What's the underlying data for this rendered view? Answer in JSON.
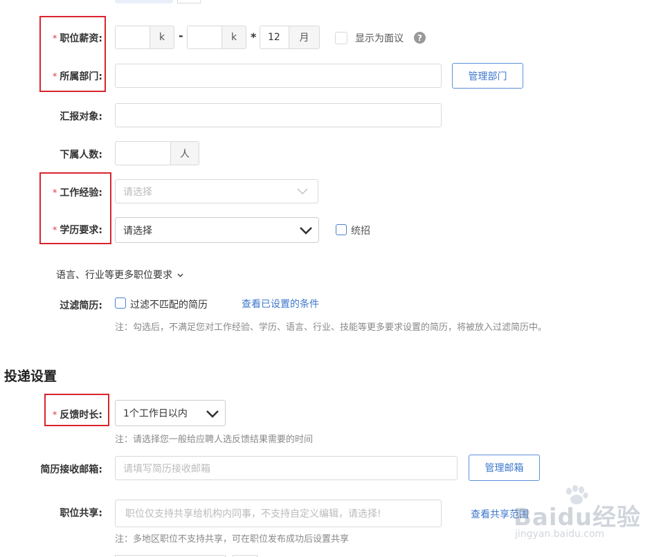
{
  "salary": {
    "label": "职位薪资:",
    "unit_k": "k",
    "dash": "-",
    "times": "*",
    "months_value": "12",
    "months_unit": "月",
    "negotiable": "显示为面议",
    "help_icon": "?"
  },
  "department": {
    "label": "所属部门:",
    "manage_button": "管理部门"
  },
  "report_to": {
    "label": "汇报对象:"
  },
  "subordinates": {
    "label": "下属人数:",
    "unit": "人"
  },
  "experience": {
    "label": "工作经验:",
    "placeholder": "请选择"
  },
  "education": {
    "label": "学历要求:",
    "value": "请选择",
    "unified": "统招"
  },
  "more_requirements": {
    "label": "语言、行业等更多职位要求"
  },
  "filter": {
    "label": "过滤简历:",
    "checkbox_label": "过滤不匹配的简历",
    "view_link": "查看已设置的条件",
    "note": "注：勾选后，不满足您对工作经验、学历、语言、行业、技能等更多要求设置的简历，将被放入过滤简历中。"
  },
  "delivery": {
    "section_title": "投递设置",
    "feedback": {
      "label": "反馈时长:",
      "value": "1个工作日以内",
      "note": "注：请选择您一般给应聘人选反馈结果需要的时间"
    },
    "email": {
      "label": "简历接收邮箱:",
      "placeholder": "请填写简历接收邮箱",
      "manage_button": "管理邮箱"
    },
    "share": {
      "label": "职位共享:",
      "placeholder": "职位仅支持共享给机构内同事，不支持自定义编辑，请选择!",
      "view_link": "查看共享范围",
      "note": "注：多地区职位不支持共享，可在职位发布成功后设置共享"
    }
  },
  "watermark": {
    "brand": "Baidu经验",
    "url": "jingyan.baidu.com"
  },
  "required_mark": "*"
}
